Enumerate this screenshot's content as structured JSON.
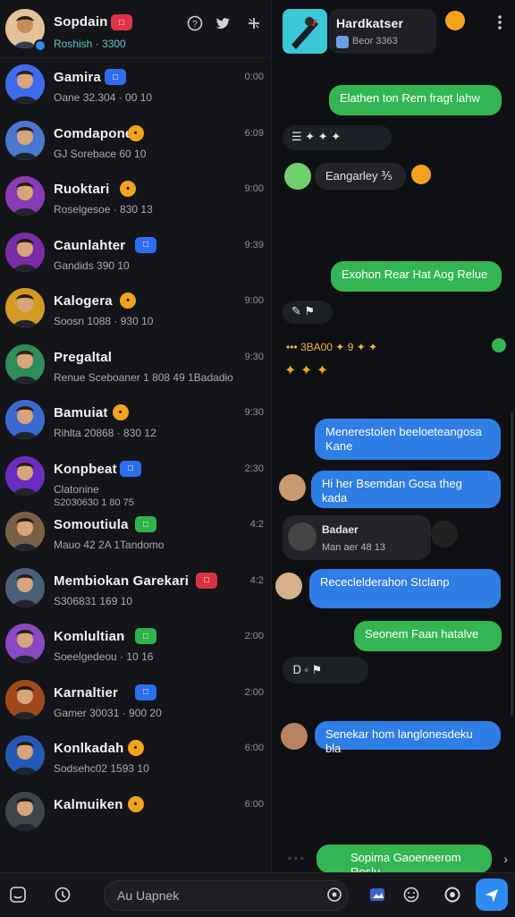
{
  "left_header": {
    "title": "Sopdain",
    "badge_color": "#e0334a",
    "subtitle": "Roshish · 3300",
    "icons": [
      "help-icon",
      "twitter-icon",
      "compose-icon"
    ]
  },
  "chats": [
    {
      "name": "Gamira",
      "sub": "Oane  32.304 · 00 10",
      "time": "0:00",
      "badge": "blue",
      "ring": "#3d6cf0"
    },
    {
      "name": "Comdapone",
      "sub": "GJ Sorebace  60 10",
      "time": "6:09",
      "badge": "emoji",
      "ring": "#4b77d1"
    },
    {
      "name": "Ruoktari",
      "sub": "Roselgesoe · 830 13",
      "time": "9:00",
      "badge": "emoji",
      "ring": "#8b3bb6"
    },
    {
      "name": "Caunlahter",
      "sub": "Gandids  390 10",
      "time": "9:39",
      "badge": "blue",
      "ring": "#7a2ca8"
    },
    {
      "name": "Kalogera",
      "sub": "Soosn  1088 · 930 10",
      "time": "9:00",
      "badge": "emoji",
      "ring": "#d29a23"
    },
    {
      "name": "Pregaltal",
      "sub": "Renue Sceboaner  1 808 49  1Badadio",
      "time": "9:30",
      "badge": "none",
      "ring": "#2f8c5b"
    },
    {
      "name": "Bamuiat",
      "sub": "Rihlta  20868 · 830 12",
      "time": "9:30",
      "badge": "emoji",
      "ring": "#3b6bd1"
    },
    {
      "name": "Konpbeat",
      "sub": "Clatonine",
      "sub2": "S2030630  1 80 75",
      "time": "2:30",
      "badge": "blue",
      "ring": "#6b2cc0"
    },
    {
      "name": "Somoutiula",
      "sub": "Mauo  42  2A  1Tandomo",
      "time": "4:2",
      "badge": "green",
      "ring": "#7b6048"
    },
    {
      "name": "Membiokan Garekari",
      "sub": "S306831  169 10",
      "time": "4:2",
      "badge": "red",
      "ring": "#49607a"
    },
    {
      "name": "Komlultian",
      "sub": "Soeelgedeou · 10 16",
      "time": "2:00",
      "badge": "green",
      "ring": "#8a49c3"
    },
    {
      "name": "Karnaltier",
      "sub": "Gamer  30031 · 900 20",
      "time": "2:00",
      "badge": "blue",
      "ring": "#a04a1c"
    },
    {
      "name": "Konlkadah",
      "sub": "Sodsehc02  1593 10",
      "time": "6:00",
      "badge": "emoji",
      "ring": "#2559b6"
    },
    {
      "name": "Kalmuiken",
      "sub": "",
      "time": "6:00",
      "badge": "emoji",
      "ring": "#3f454d"
    }
  ],
  "right_header": {
    "title": "Hardkatser",
    "subtitle": "Beor 3363",
    "menu_icon": "more-vertical-icon"
  },
  "messages": [
    {
      "id": "m1",
      "type": "out",
      "color": "green",
      "text": "Elathen ton Rem fragt lahw"
    },
    {
      "id": "m2",
      "type": "in-icons",
      "text": "☰ ✦ ✦ ✦"
    },
    {
      "id": "m3",
      "type": "in",
      "color": "dark",
      "text": "Eangarley  ⅗"
    },
    {
      "id": "m4",
      "type": "out",
      "color": "green",
      "text": "Exohon Rear Hat Aog Relue"
    },
    {
      "id": "m5",
      "type": "in-icons",
      "text": "✎ ⚑"
    },
    {
      "id": "m6",
      "type": "sys",
      "text": "•••  3BA00  ✦  9 ✦ ✦"
    },
    {
      "id": "m7",
      "type": "in-icons",
      "text": "✦ ✦ ✦"
    },
    {
      "id": "m8",
      "type": "out",
      "color": "blue",
      "text": "Menerestolen beeloeteangosa Kane"
    },
    {
      "id": "m9",
      "type": "in",
      "color": "blue",
      "text": "Hi her Bsemdan Gosa theg kada"
    },
    {
      "id": "m10",
      "type": "in",
      "color": "dark",
      "text": "Badaer",
      "text2": "Man aer  48  13"
    },
    {
      "id": "m11",
      "type": "in",
      "color": "blue",
      "text": "Receclelderahon Stclanp"
    },
    {
      "id": "m12",
      "type": "out",
      "color": "green",
      "text": "Seonem Faan hatalve"
    },
    {
      "id": "m13",
      "type": "in",
      "color": "dark",
      "text": "Ꭰ  ◦  ⚑"
    },
    {
      "id": "m14",
      "type": "in",
      "color": "blue",
      "text": "Senekar hom langlonesdeku bla"
    },
    {
      "id": "m15",
      "type": "out",
      "color": "green",
      "text": "Sopima Gaoeneerom Roslu"
    }
  ],
  "composer": {
    "placeholder": "Au Uapnek",
    "left_icons": [
      "sticker-icon",
      "attach-icon"
    ],
    "right_icons": [
      "gallery-icon",
      "emoji-icon",
      "record-icon",
      "send-icon"
    ],
    "send_color": "#2d8cf0"
  }
}
